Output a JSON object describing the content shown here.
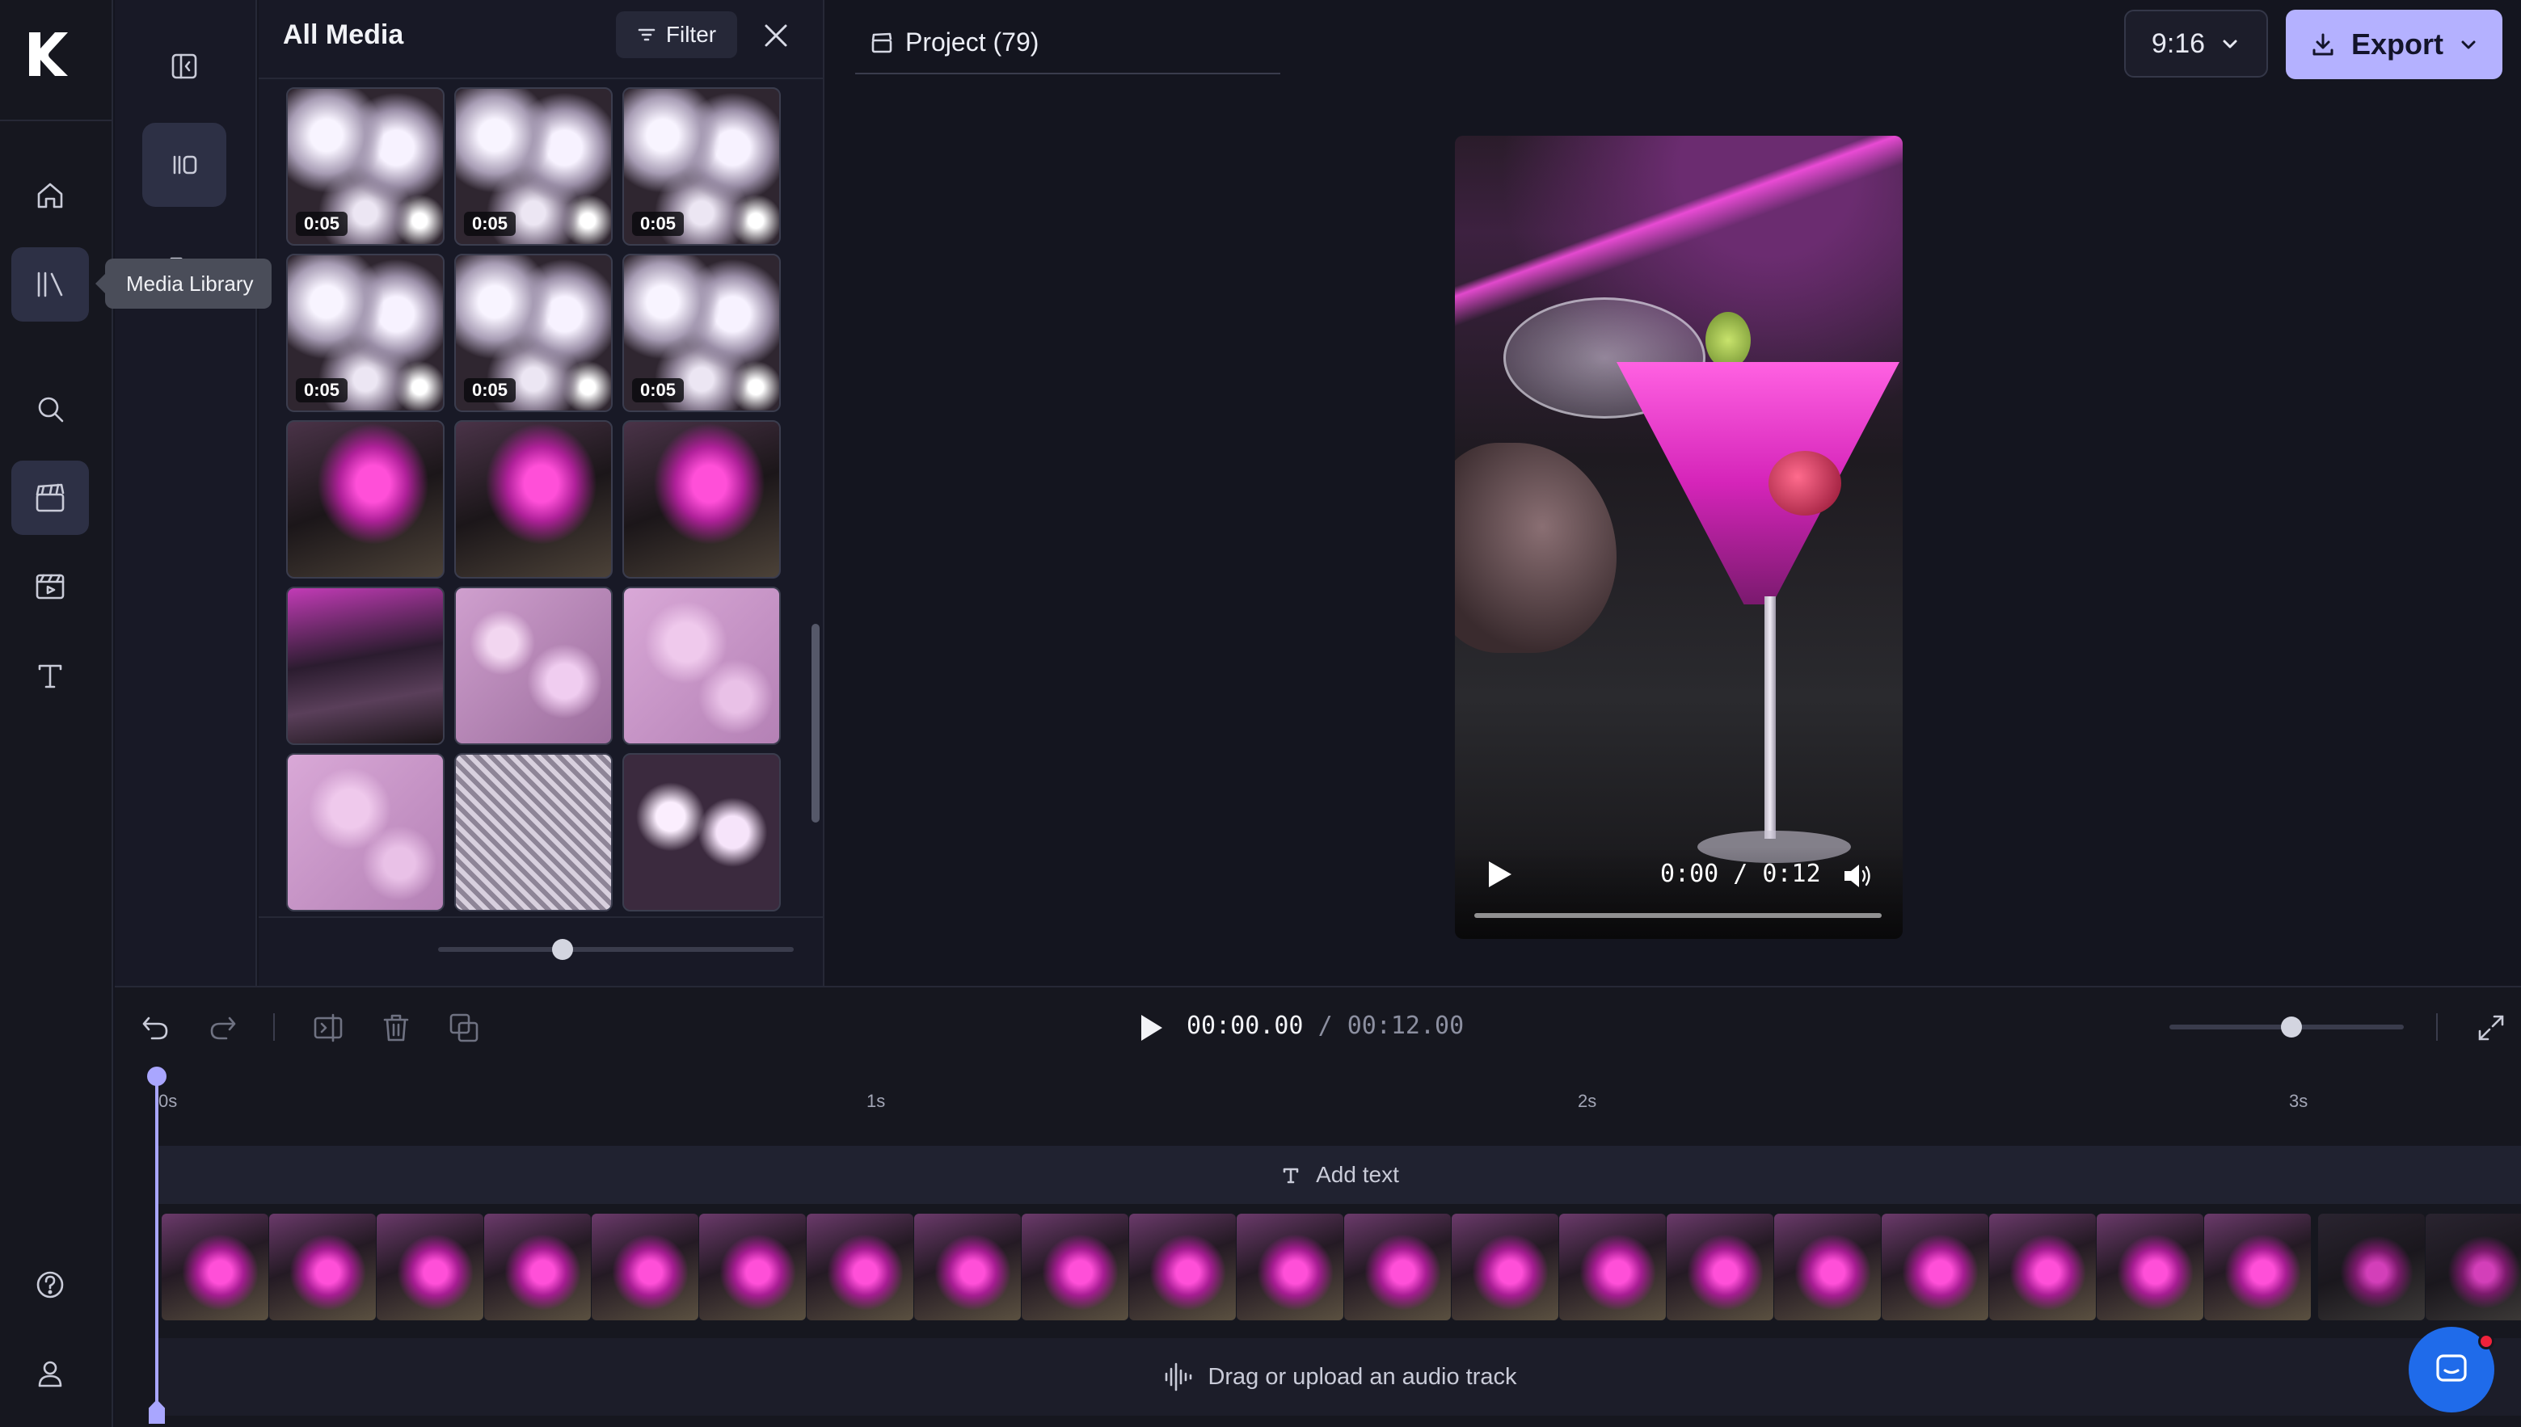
{
  "sidebar": {
    "logo_icon": "kapwing-logo",
    "items": [
      {
        "name": "home",
        "icon": "home-icon",
        "active": false
      },
      {
        "name": "media-library",
        "icon": "library-icon",
        "active": true
      },
      {
        "name": "search",
        "icon": "search-icon",
        "active": false
      },
      {
        "name": "projects",
        "icon": "clapperboard-icon",
        "active": true
      },
      {
        "name": "templates",
        "icon": "film-icon",
        "active": false
      },
      {
        "name": "text",
        "icon": "text-icon",
        "active": false
      }
    ],
    "bottom_items": [
      {
        "name": "help",
        "icon": "help-icon"
      },
      {
        "name": "account",
        "icon": "user-icon"
      }
    ],
    "tooltip": "Media Library"
  },
  "media_panel": {
    "title": "All Media",
    "filter_label": "Filter",
    "thumbnails": [
      {
        "style": "disco",
        "duration": "0:05"
      },
      {
        "style": "disco",
        "duration": "0:05"
      },
      {
        "style": "disco",
        "duration": "0:05"
      },
      {
        "style": "disco",
        "duration": "0:05"
      },
      {
        "style": "disco",
        "duration": "0:05"
      },
      {
        "style": "disco",
        "duration": "0:05"
      },
      {
        "style": "glass",
        "duration": ""
      },
      {
        "style": "glass",
        "duration": ""
      },
      {
        "style": "glass",
        "duration": ""
      },
      {
        "style": "bar",
        "duration": ""
      },
      {
        "style": "bubble",
        "duration": ""
      },
      {
        "style": "pinkb",
        "duration": ""
      },
      {
        "style": "pinkb",
        "duration": ""
      },
      {
        "style": "mirror",
        "duration": ""
      },
      {
        "style": "bubdark",
        "duration": ""
      }
    ],
    "thumbnail_zoom": 0.35
  },
  "header": {
    "project_name": "Project (79)",
    "aspect_ratio": "9:16",
    "export_label": "Export",
    "accent_color": "#b4b1ff"
  },
  "preview": {
    "time_display": "0:00 / 0:12",
    "progress": 0
  },
  "timeline": {
    "current_time": "00:00.00",
    "separator": "/",
    "total_time": "00:12.00",
    "zoom": 0.52,
    "ticks": [
      "0s",
      "1s",
      "2s",
      "3s"
    ],
    "add_text_label": "Add text",
    "audio_placeholder": "Drag or upload an audio track",
    "playhead_color": "#a9a6ff"
  }
}
